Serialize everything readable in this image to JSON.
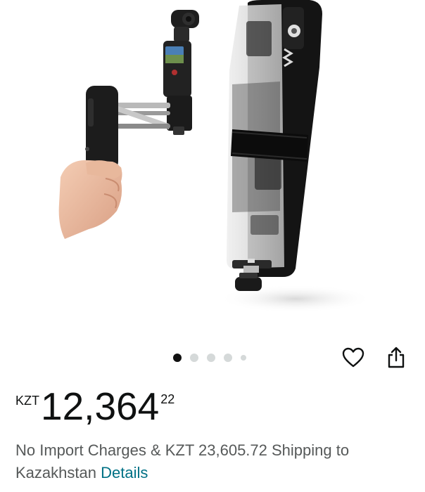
{
  "gallery": {
    "image_alt": "Vertical handheld grip stand with camera mount and clear phone holder",
    "dot_count": 5,
    "active_index": 0
  },
  "actions": {
    "favorite_icon": "heart-outline-icon",
    "share_icon": "share-upload-icon"
  },
  "price": {
    "currency": "KZT",
    "whole": "12,364",
    "fraction": "22"
  },
  "shipping": {
    "text": "No Import Charges & KZT 23,605.72 Shipping to Kazakhstan",
    "details_link": "Details"
  },
  "colors": {
    "link": "#007185",
    "text": "#0f1111",
    "secondary_text": "#565959",
    "dot_active": "#111111",
    "dot_inactive": "#d5d9d9"
  }
}
